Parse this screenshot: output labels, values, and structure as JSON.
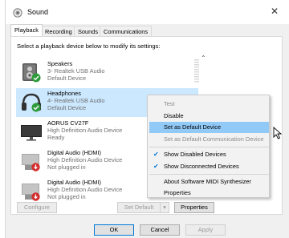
{
  "window": {
    "title": "Sound",
    "app_icon": "speaker-icon",
    "close_icon": "close-icon"
  },
  "tabs": [
    {
      "label": "Playback"
    },
    {
      "label": "Recording"
    },
    {
      "label": "Sounds"
    },
    {
      "label": "Communications"
    }
  ],
  "instruction": "Select a playback device below to modify its settings:",
  "devices": [
    {
      "name": "Speakers",
      "line2": "3- Realtek USB Audio",
      "line3": "Default Device",
      "icon": "speakers-icon",
      "status": "default-check"
    },
    {
      "name": "Headphones",
      "line2": "4- Realtek USB Audio",
      "line3": "Default Device",
      "icon": "headphones-icon",
      "status": "default-check"
    },
    {
      "name": "AORUS CV27F",
      "line2": "High Definition Audio Device",
      "line3": "Ready",
      "icon": "monitor-icon",
      "status": ""
    },
    {
      "name": "Digital Audio (HDMI)",
      "line2": "High Definition Audio Device",
      "line3": "Not plugged in",
      "icon": "hdmi-device-icon",
      "status": "not-plugged"
    },
    {
      "name": "Digital Audio (HDMI)",
      "line2": "High Definition Audio Device",
      "line3": "Not plugged in",
      "icon": "hdmi-device-icon",
      "status": "not-plugged"
    }
  ],
  "buttons": {
    "configure": "Configure",
    "set_default": "Set Default",
    "set_default_dropdown": "▾",
    "properties": "Properties",
    "ok": "OK",
    "cancel": "Cancel",
    "apply": "Apply"
  },
  "context_menu": {
    "items": [
      {
        "label": "Test",
        "disabled": true
      },
      {
        "label": "Disable"
      },
      {
        "label": "Set as Default Device",
        "highlighted": true
      },
      {
        "label": "Set as Default Communication Device",
        "disabled": true
      },
      {
        "label": "Show Disabled Devices",
        "checked": true
      },
      {
        "label": "Show Disconnected Devices",
        "checked": true
      },
      {
        "label": "About Software MIDI Synthesizer"
      },
      {
        "label": "Properties"
      }
    ]
  },
  "colors": {
    "selection": "#cce8ff",
    "menu_highlight": "#91c9f7",
    "accent": "#0078d7",
    "default_check": "#2e9b3a",
    "not_plugged": "#d32f2f"
  }
}
